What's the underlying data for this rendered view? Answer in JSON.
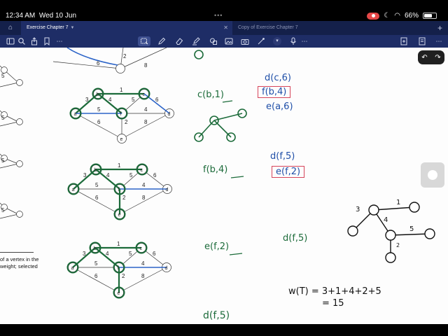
{
  "status": {
    "time": "12:34 AM",
    "date": "Wed 10 Jun",
    "battery": "66%"
  },
  "tabs": [
    {
      "label": "Exercise Chapter 7",
      "active": true
    },
    {
      "label": "Copy of Exercise Chapter 7",
      "active": false
    }
  ],
  "toolbar_icons": [
    "sidebar-icon",
    "search-icon",
    "share-icon",
    "bookmark-icon",
    "lasso-icon",
    "pen-icon",
    "eraser-icon",
    "highlighter-icon",
    "shapes-icon",
    "laser-icon",
    "image-icon",
    "camera-icon",
    "text-icon",
    "link-icon",
    "mic-icon",
    "more-icon"
  ],
  "document": {
    "caption_line1": "of a vertex in the",
    "caption_line2": "weight; selected"
  },
  "edge_weights": {
    "ab": "3",
    "bc": "1",
    "bf": "4",
    "cf": "5",
    "af": "5",
    "cd": "6",
    "fd": "4",
    "fe": "2",
    "ae": "6",
    "ed": "8"
  },
  "margin_weights": [
    "5",
    "5",
    "5",
    "5"
  ],
  "handwriting": {
    "step1_label": "c(b,1)",
    "step1_candidates": [
      "d(c,6)",
      "f(b,4)",
      "e(a,6)"
    ],
    "step2_label": "f(b,4)",
    "step2_candidates": [
      "d(f,5)",
      "e(f,2)"
    ],
    "step3_label": "e(f,2)",
    "step3_candidate": "d(f,5)",
    "step4_label": "d(f,5)",
    "final_weights": {
      "ab": "3",
      "bc": "1",
      "bf": "4",
      "fd": "5",
      "fe": "2"
    },
    "total_line1": "w(T) = 3+1+4+2+5",
    "total_line2": "= 15"
  },
  "colors": {
    "app_bar": "#1e2d66",
    "highlight_blue": "#2c64c8",
    "ink_green": "#1c6b3a",
    "box_red": "#d6445a"
  }
}
